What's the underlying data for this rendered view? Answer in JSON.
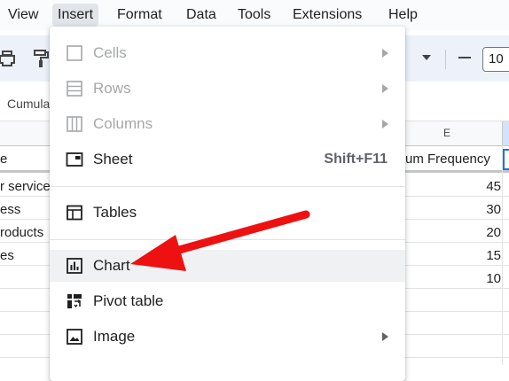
{
  "menubar": {
    "items": [
      {
        "label": "View"
      },
      {
        "label": "Insert"
      },
      {
        "label": "Format"
      },
      {
        "label": "Data"
      },
      {
        "label": "Tools"
      },
      {
        "label": "Extensions"
      },
      {
        "label": "Help"
      }
    ],
    "active": "Insert"
  },
  "toolbar": {
    "font_size": "10",
    "icons": [
      "print-icon",
      "paint-format-icon"
    ]
  },
  "formula_row": {
    "name_box": "Cumula"
  },
  "grid": {
    "column_e_header": "E",
    "header_row": {
      "col_a": "e",
      "col_e": "um Frequency"
    },
    "rows": [
      {
        "col_a": "r service",
        "col_e": "45"
      },
      {
        "col_a": "ess",
        "col_e": "30"
      },
      {
        "col_a": "roducts",
        "col_e": "20"
      },
      {
        "col_a": "es",
        "col_e": "15"
      },
      {
        "col_a": "",
        "col_e": "10"
      }
    ]
  },
  "insert_menu": {
    "items": [
      {
        "label": "Cells",
        "icon": "cells-icon",
        "disabled": true,
        "submenu": true
      },
      {
        "label": "Rows",
        "icon": "rows-icon",
        "disabled": true,
        "submenu": true
      },
      {
        "label": "Columns",
        "icon": "columns-icon",
        "disabled": true,
        "submenu": true
      },
      {
        "label": "Sheet",
        "icon": "sheet-icon",
        "shortcut": "Shift+F11"
      },
      {
        "label": "Tables",
        "icon": "table-icon"
      },
      {
        "label": "Chart",
        "icon": "chart-icon",
        "highlighted": true
      },
      {
        "label": "Pivot table",
        "icon": "pivot-table-icon"
      },
      {
        "label": "Image",
        "icon": "image-icon",
        "submenu": true
      }
    ]
  },
  "colors": {
    "annotation_arrow": "#ee1111",
    "selection_blue": "#1a73e8",
    "menu_hover": "#eff1f3",
    "disabled_text": "#a5a7a9"
  }
}
